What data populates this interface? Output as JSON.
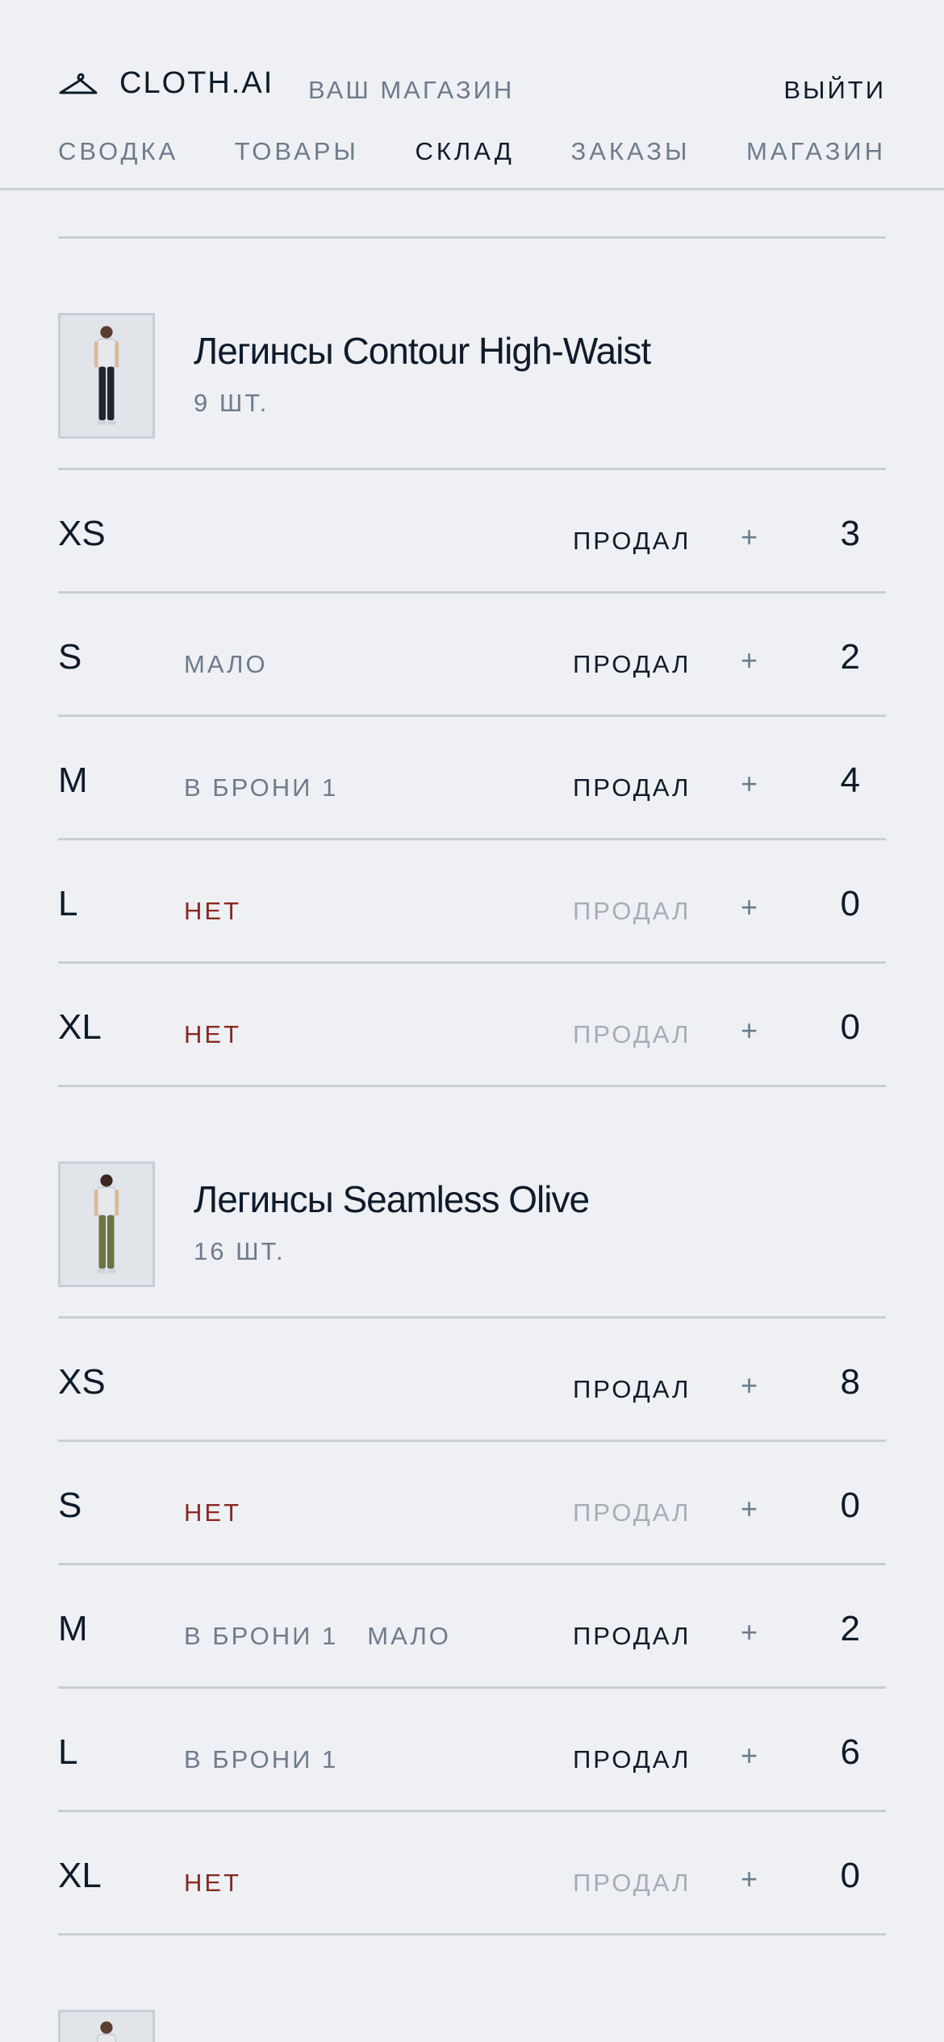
{
  "header": {
    "brand": "CLOTH.AI",
    "brand_icon": "hanger-icon",
    "store": "ВАШ МАГАЗИН",
    "logout": "ВЫЙТИ",
    "nav": [
      {
        "label": "СВОДКА",
        "active": false
      },
      {
        "label": "ТОВАРЫ",
        "active": false
      },
      {
        "label": "СКЛАД",
        "active": true
      },
      {
        "label": "ЗАКАЗЫ",
        "active": false
      },
      {
        "label": "МАГАЗИН",
        "active": false
      }
    ]
  },
  "colors": {
    "background": "#eef0f3",
    "text": "#0f1b2a",
    "muted": "#6e7b8b",
    "out_of_stock": "#8a2a24",
    "disabled": "#a6adb7",
    "divider": "#c9ced6"
  },
  "products": [
    {
      "title": "Легинсы Contour High-Waist",
      "count": "9 ШТ.",
      "sizes": [
        {
          "size": "XS",
          "tags": [],
          "sold": "ПРОДАЛ",
          "sold_enabled": true,
          "plus": "+",
          "qty": "3"
        },
        {
          "size": "S",
          "tags": [
            {
              "text": "МАЛО",
              "type": "low"
            }
          ],
          "sold": "ПРОДАЛ",
          "sold_enabled": true,
          "plus": "+",
          "qty": "2"
        },
        {
          "size": "M",
          "tags": [
            {
              "text": "В БРОНИ 1",
              "type": "reserved"
            }
          ],
          "sold": "ПРОДАЛ",
          "sold_enabled": true,
          "plus": "+",
          "qty": "4"
        },
        {
          "size": "L",
          "tags": [
            {
              "text": "НЕТ",
              "type": "none"
            }
          ],
          "sold": "ПРОДАЛ",
          "sold_enabled": false,
          "plus": "+",
          "qty": "0"
        },
        {
          "size": "XL",
          "tags": [
            {
              "text": "НЕТ",
              "type": "none"
            }
          ],
          "sold": "ПРОДАЛ",
          "sold_enabled": false,
          "plus": "+",
          "qty": "0"
        }
      ]
    },
    {
      "title": "Легинсы Seamless Olive",
      "count": "16 ШТ.",
      "sizes": [
        {
          "size": "XS",
          "tags": [],
          "sold": "ПРОДАЛ",
          "sold_enabled": true,
          "plus": "+",
          "qty": "8"
        },
        {
          "size": "S",
          "tags": [
            {
              "text": "НЕТ",
              "type": "none"
            }
          ],
          "sold": "ПРОДАЛ",
          "sold_enabled": false,
          "plus": "+",
          "qty": "0"
        },
        {
          "size": "M",
          "tags": [
            {
              "text": "В БРОНИ 1",
              "type": "reserved"
            },
            {
              "text": "МАЛО",
              "type": "low"
            }
          ],
          "sold": "ПРОДАЛ",
          "sold_enabled": true,
          "plus": "+",
          "qty": "2"
        },
        {
          "size": "L",
          "tags": [
            {
              "text": "В БРОНИ 1",
              "type": "reserved"
            }
          ],
          "sold": "ПРОДАЛ",
          "sold_enabled": true,
          "plus": "+",
          "qty": "6"
        },
        {
          "size": "XL",
          "tags": [
            {
              "text": "НЕТ",
              "type": "none"
            }
          ],
          "sold": "ПРОДАЛ",
          "sold_enabled": false,
          "plus": "+",
          "qty": "0"
        }
      ]
    }
  ]
}
